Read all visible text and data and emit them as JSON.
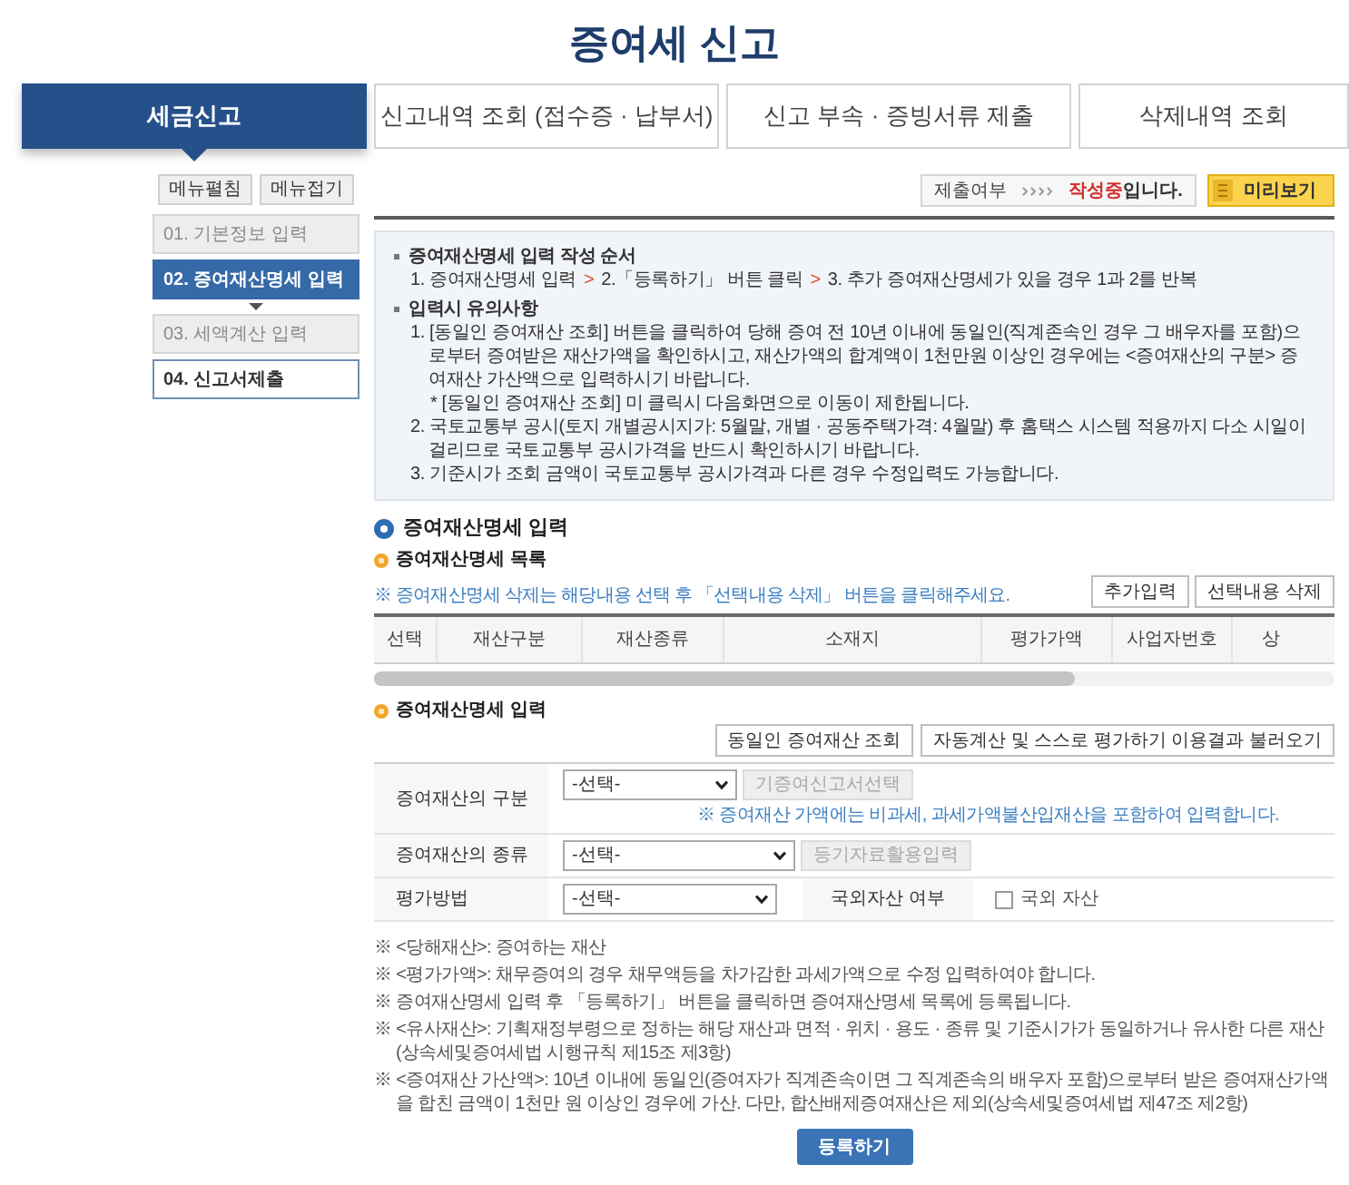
{
  "page_title": "증여세 신고",
  "tabs": [
    {
      "label": "세금신고",
      "selected": true
    },
    {
      "label": "신고내역 조회 (접수증 · 납부서)",
      "selected": false
    },
    {
      "label": "신고 부속 · 증빙서류 제출",
      "selected": false
    },
    {
      "label": "삭제내역 조회",
      "selected": false
    }
  ],
  "sidebar": {
    "buttons": [
      "메뉴펼침",
      "메뉴접기"
    ],
    "items": [
      {
        "label": "01. 기본정보 입력",
        "selected": false,
        "disabled": true
      },
      {
        "label": "02. 증여재산명세 입력",
        "selected": true,
        "disabled": false
      },
      {
        "label": "03. 세액계산 입력",
        "selected": false,
        "disabled": true
      },
      {
        "label": "04. 신고서제출",
        "selected": false,
        "disabled": false
      }
    ]
  },
  "status_bar": {
    "label": "제출여부",
    "status": "작성중",
    "status_suffix": "입니다.",
    "preview_button": "미리보기"
  },
  "guide": {
    "order": {
      "heading": "증여재산명세 입력 작성 순서",
      "steps": [
        "1. 증여재산명세 입력",
        "2.「등록하기」 버튼 클릭",
        "3. 추가 증여재산명세가 있을 경우 1과 2를 반복"
      ],
      "separator": ">"
    },
    "cautions": {
      "heading": "입력시 유의사항",
      "items": [
        {
          "text": "1. [동일인 증여재산 조회] 버튼을 클릭하여 당해 증여 전 10년 이내에 동일인(직계존속인 경우 그 배우자를 포함)으로부터 증여받은 재산가액을 확인하시고, 재산가액의 합계액이 1천만원 이상인 경우에는 <증여재산의 구분> 증여재산 가산액으로 입력하시기 바랍니다.",
          "notes": [
            "* [동일인 증여재산 조회] 미 클릭시 다음화면으로 이동이 제한됩니다."
          ]
        },
        {
          "text": "2. 국토교통부 공시(토지 개별공시지가: 5월말, 개별 · 공동주택가격: 4월말) 후 홈택스 시스템 적용까지 다소 시일이 걸리므로 국토교통부 공시가격을 반드시 확인하시기 바랍니다."
        },
        {
          "text": "3. 기준시가 조회 금액이 국토교통부 공시가격과 다른 경우 수정입력도 가능합니다."
        }
      ]
    }
  },
  "section": {
    "title": "증여재산명세 입력",
    "list": {
      "title": "증여재산명세 목록",
      "note": "※ 증여재산명세 삭제는 해당내용 선택 후 「선택내용 삭제」 버튼을 클릭해주세요.",
      "buttons": [
        "추가입력",
        "선택내용 삭제"
      ],
      "columns": [
        "선택",
        "재산구분",
        "재산종류",
        "소재지",
        "평가가액",
        "사업자번호",
        "상"
      ]
    },
    "form": {
      "title": "증여재산명세 입력",
      "buttons": [
        "동일인 증여재산 조회",
        "자동계산 및 스스로 평가하기 이용결과 불러오기"
      ],
      "rows": [
        {
          "label": "증여재산의 구분",
          "select": "-선택-",
          "button": {
            "label": "기증여신고서선택",
            "disabled": true
          },
          "note": "※ 증여재산 가액에는 비과세, 과세가액불산입재산을 포함하여 입력합니다."
        },
        {
          "label": "증여재산의 종류",
          "select": "-선택-",
          "button": {
            "label": "등기자료활용입력",
            "disabled": true
          }
        },
        {
          "label": "평가방법",
          "select": "-선택-",
          "side_label": "국외자산 여부",
          "checkbox": {
            "label": "국외 자산",
            "checked": false
          }
        }
      ]
    }
  },
  "footnotes": [
    "※ <당해재산>: 증여하는 재산",
    "※ <평가가액>: 채무증여의 경우 채무액등을 차가감한 과세가액으로 수정 입력하여야 합니다.",
    "※ 증여재산명세 입력 후 「등록하기」 버튼을 클릭하면 증여재산명세 목록에 등록됩니다.",
    "※ <유사재산>: 기획재정부령으로 정하는 해당 재산과 면적 · 위치 · 용도 · 종류 및 기준시가가 동일하거나 유사한 다른 재산(상속세및증여세법 시행규칙 제15조 제3항)",
    "※ <증여재산 가산액>: 10년 이내에 동일인(증여자가 직계존속이면 그 직계존속의 배우자 포함)으로부터 받은 증여재산가액을 합친 금액이 1천만 원 이상인 경우에 가산. 다만, 합산배제증여재산은 제외(상속세및증여세법 제47조 제2항)"
  ],
  "submit_button": "등록하기"
}
